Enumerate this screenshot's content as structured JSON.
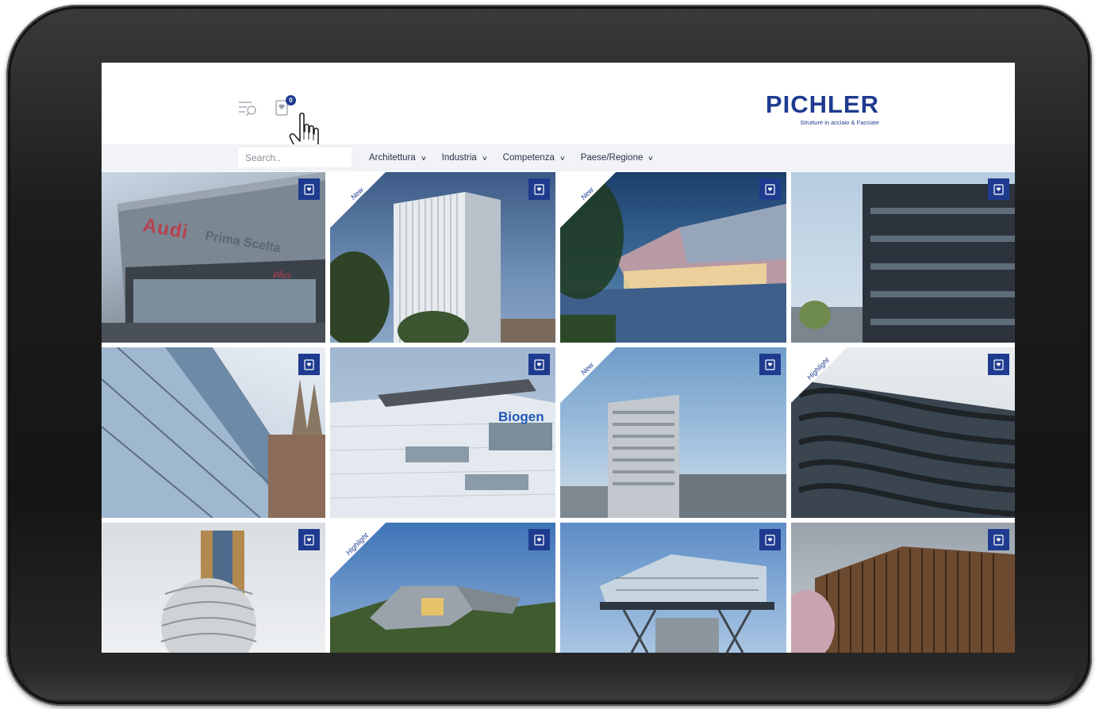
{
  "brand": {
    "logo": "PICHLER",
    "tagline": "Strutture in acciaio & Facciate",
    "color": "#1e3b8f"
  },
  "header": {
    "menu_icon": "menu-search-icon",
    "wishlist_icon": "bookmark-heart-icon",
    "wishlist_count": "0"
  },
  "search": {
    "placeholder": "Search.."
  },
  "nav": {
    "items": [
      {
        "label": "Architettura"
      },
      {
        "label": "Industria"
      },
      {
        "label": "Competenza"
      },
      {
        "label": "Paese/Regione"
      }
    ]
  },
  "tiles": [
    {
      "badge": "",
      "subject": "Audi Prima Scelta"
    },
    {
      "badge": "New",
      "subject": "tower"
    },
    {
      "badge": "New",
      "subject": "mosaic facade"
    },
    {
      "badge": "",
      "subject": "office"
    },
    {
      "badge": "",
      "subject": "glass facade"
    },
    {
      "badge": "",
      "subject": "Biogen"
    },
    {
      "badge": "New",
      "subject": "skyscraper"
    },
    {
      "badge": "Highlight",
      "subject": "curved balconies"
    },
    {
      "badge": "",
      "subject": "round tower"
    },
    {
      "badge": "Highlight",
      "subject": "museum"
    },
    {
      "badge": "",
      "subject": "glass pavilion"
    },
    {
      "badge": "",
      "subject": "wooden facade"
    }
  ],
  "tile_labels": {
    "t0": "Audi",
    "t0b": "Prima Scelta",
    "t0c": "plus",
    "t5": "Biogen"
  }
}
